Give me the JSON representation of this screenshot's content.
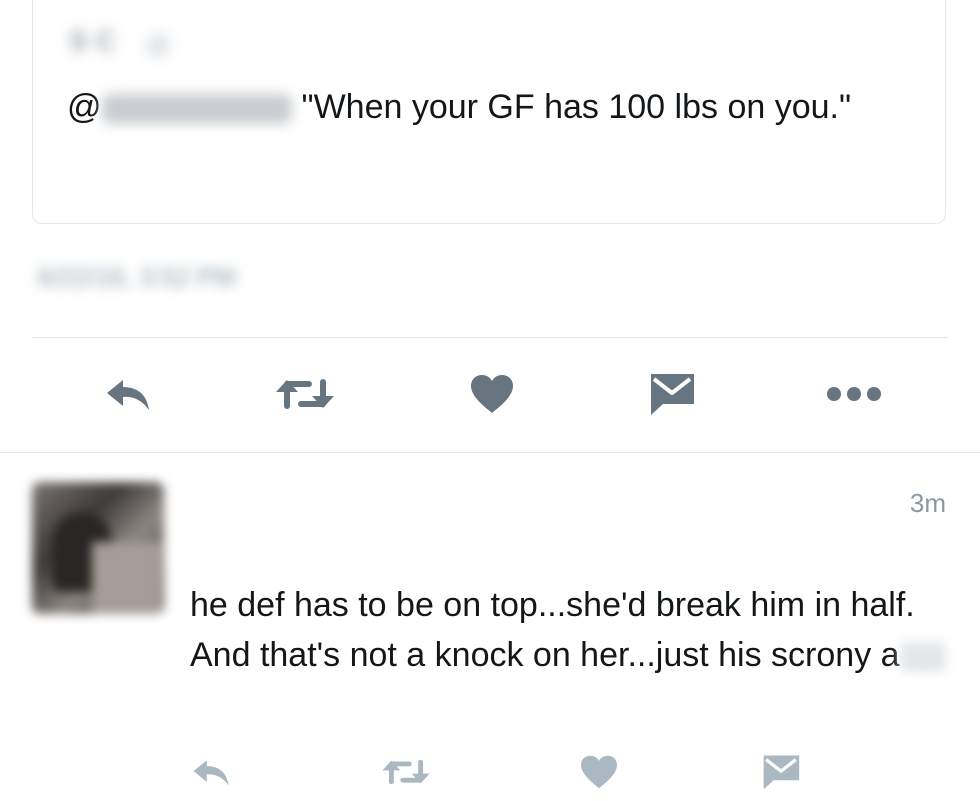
{
  "quoted_tweet": {
    "author_name": "S C",
    "author_handle": "@",
    "text_prefix": "@",
    "text": "\"When your GF has 100 lbs on you.\""
  },
  "tweet": {
    "timestamp": "6/22/16, 3:52 PM"
  },
  "actions": [
    "reply-icon",
    "retweet-icon",
    "like-icon",
    "message-icon",
    "more-icon"
  ],
  "reply": {
    "author_name": "",
    "author_handle": "",
    "time": "3m",
    "replying_to": "",
    "text": "he def has to be on top...she'd break him in half. And that's not a knock on her...just his scrony a"
  },
  "colors": {
    "icon": "#66757f",
    "icon_light": "#aab8c2",
    "divider": "#e1e8ed",
    "link": "#1da1f2"
  }
}
